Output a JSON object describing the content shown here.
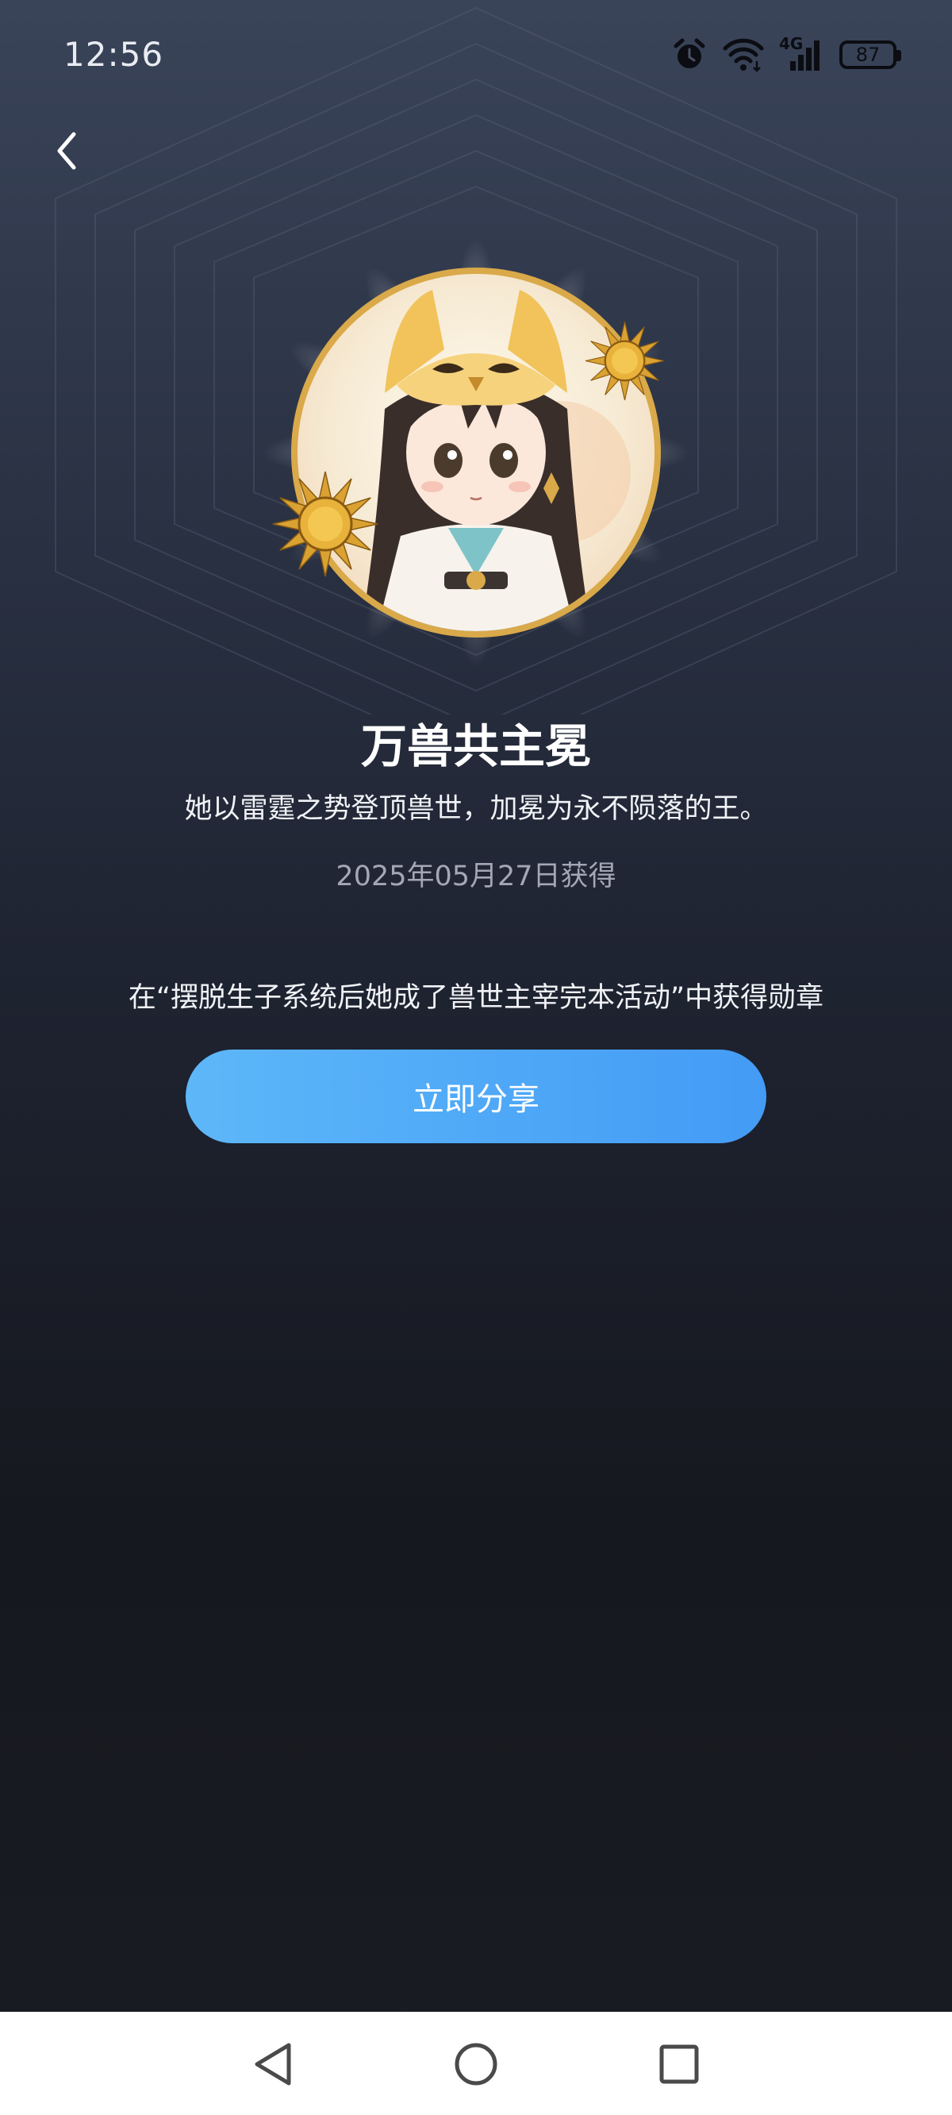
{
  "status_bar": {
    "time": "12:56",
    "network": "4G",
    "battery": "87",
    "icons": [
      "alarm-icon",
      "wifi-icon",
      "cellular-signal-icon",
      "battery-icon"
    ]
  },
  "header": {
    "back_icon": "chevron-left-icon"
  },
  "medal": {
    "title": "万兽共主冕",
    "description": "她以雷霆之势登顶兽世，加冕为永不陨落的王。",
    "acquired_date": "2025年05月27日获得",
    "source": "在“摆脱生子系统后她成了兽世主宰完本活动”中获得勋章"
  },
  "actions": {
    "share_label": "立即分享"
  },
  "nav_bar": {
    "icons": [
      "back-triangle-icon",
      "home-circle-icon",
      "recents-square-icon"
    ]
  },
  "colors": {
    "share_gradient_start": "#5db7f8",
    "share_gradient_end": "#449bf5",
    "medal_ring": "#d9a94a",
    "background_top": "#3a4459",
    "background_bottom": "#16181f"
  }
}
